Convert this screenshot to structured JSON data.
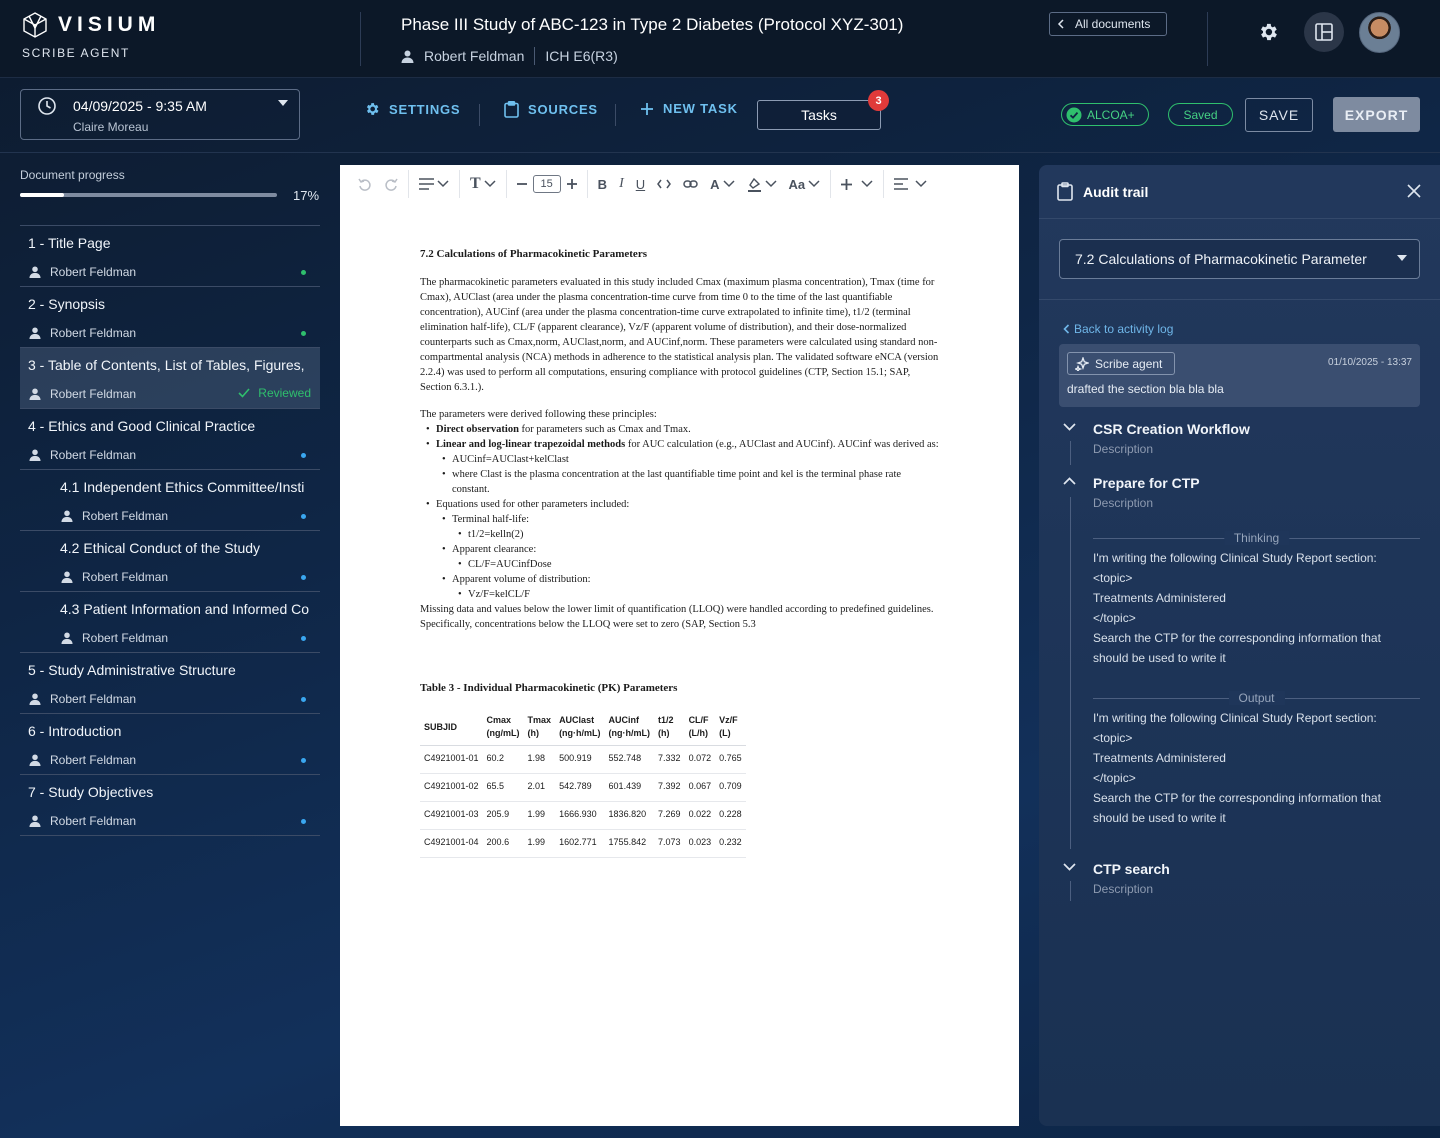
{
  "header": {
    "brand": "VISIUM",
    "brand_sub": "SCRIBE AGENT",
    "doc_title": "Phase III Study of ABC-123 in Type 2 Diabetes (Protocol XYZ-301)",
    "author": "Robert Feldman",
    "guideline": "ICH E6(R3)",
    "all_documents_label": "All documents",
    "icons": [
      "visium-logo-icon",
      "person-icon",
      "chevron-left-icon",
      "gear-icon",
      "layout-icon"
    ]
  },
  "toolbar": {
    "date": "04/09/2025 - 9:35 AM",
    "date_user": "Claire Moreau",
    "settings_label": "SETTINGS",
    "sources_label": "SOURCES",
    "new_task_label": "NEW TASK",
    "tasks_label": "Tasks",
    "tasks_count": "3",
    "alcoa_label": "ALCOA+",
    "saved_label": "Saved",
    "save_label": "SAVE",
    "export_label": "EXPORT",
    "colors": {
      "accent": "#6fc0ef",
      "success": "#2fbf6d",
      "badge": "#e03a3a"
    }
  },
  "sidebar": {
    "progress_label": "Document progress",
    "progress_pct": "17%",
    "progress_value": 0.17,
    "items": [
      {
        "title": "1 - Title Page",
        "user": "Robert Feldman",
        "status": "green"
      },
      {
        "title": "2 - Synopsis",
        "user": "Robert Feldman",
        "status": "green"
      },
      {
        "title": "3 - Table of Contents, List of Tables, Figures,",
        "user": "Robert Feldman",
        "status": "reviewed",
        "reviewed_label": "Reviewed"
      },
      {
        "title": "4 - Ethics and Good Clinical Practice",
        "user": "Robert Feldman",
        "status": "blue"
      },
      {
        "title": "4.1 Independent Ethics Committee/Insti",
        "user": "Robert Feldman",
        "status": "blue"
      },
      {
        "title": "4.2 Ethical Conduct of the Study",
        "user": "Robert Feldman",
        "status": "blue"
      },
      {
        "title": "4.3 Patient Information and Informed Co",
        "user": "Robert Feldman",
        "status": "blue"
      },
      {
        "title": "5 - Study Administrative Structure",
        "user": "Robert Feldman",
        "status": "blue"
      },
      {
        "title": "6 - Introduction",
        "user": "Robert Feldman",
        "status": "blue"
      },
      {
        "title": "7 - Study Objectives",
        "user": "Robert Feldman",
        "status": "blue"
      }
    ]
  },
  "editor": {
    "font_size": "15",
    "section_title": "7.2 Calculations of Pharmacokinetic Parameters",
    "para1": "The pharmacokinetic parameters evaluated in this study included Cmax (maximum plasma concentration), Tmax (time for Cmax), AUClast (area under the plasma concentration-time curve from time 0 to the time of the last quantifiable concentration), AUCinf (area under the plasma concentration-time curve extrapolated to infinite time), t1/2 (terminal elimination half-life), CL/F (apparent clearance), Vz/F (apparent volume of distribution), and their dose-normalized counterparts such as Cmax,norm, AUClast,norm, and AUCinf,norm. These parameters were calculated using standard non-compartmental analysis (NCA) methods in adherence to the statistical analysis plan. The validated software eNCA (version 2.2.4) was used to perform all computations, ensuring compliance with protocol guidelines (CTP, Section 15.1; SAP, Section 6.3.1.).",
    "principles_intro": "The parameters were derived following these principles:",
    "b1_bold": "Direct observation",
    "b1_rest": " for parameters such as Cmax and Tmax.",
    "b2_bold": "Linear and log-linear trapezoidal methods",
    "b2_rest": " for AUC calculation (e.g., AUClast and AUCinf). AUCinf was derived as:",
    "b2_sub1": "AUCinf=AUClast+kelClast",
    "b2_sub2": "where Clast is the plasma concentration at the last quantifiable time point and kel is the terminal phase rate constant.",
    "b3": "Equations used for other parameters included:",
    "b3_s1": "Terminal half-life:",
    "b3_s1_f": "t1/2=kelln(2)",
    "b3_s2": "Apparent clearance:",
    "b3_s2_f": "CL/F=AUCinfDose",
    "b3_s3": "Apparent volume of distribution:",
    "b3_s3_f": "Vz/F=kelCL/F",
    "para_missing": "Missing data and values below the lower limit of quantification (LLOQ) were handled according to predefined guidelines. Specifically, concentrations below the LLOQ were set to zero (SAP, Section 5.3",
    "table_title": "Table 3 -  Individual Pharmacokinetic (PK) Parameters",
    "table": {
      "headers": [
        [
          "SUBJID",
          ""
        ],
        [
          "Cmax",
          "(ng/mL)"
        ],
        [
          "Tmax",
          "(h)"
        ],
        [
          "AUClast",
          "(ng·h/mL)"
        ],
        [
          "AUCinf",
          "(ng·h/mL)"
        ],
        [
          "t1/2",
          "(h)"
        ],
        [
          "CL/F",
          "(L/h)"
        ],
        [
          "Vz/F",
          "(L)"
        ]
      ],
      "rows": [
        [
          "C4921001-01",
          "60.2",
          "1.98",
          "500.919",
          "552.748",
          "7.332",
          "0.072",
          "0.765"
        ],
        [
          "C4921001-02",
          "65.5",
          "2.01",
          "542.789",
          "601.439",
          "7.392",
          "0.067",
          "0.709"
        ],
        [
          "C4921001-03",
          "205.9",
          "1.99",
          "1666.930",
          "1836.820",
          "7.269",
          "0.022",
          "0.228"
        ],
        [
          "C4921001-04",
          "200.6",
          "1.99",
          "1602.771",
          "1755.842",
          "7.073",
          "0.023",
          "0.232"
        ]
      ]
    }
  },
  "audit": {
    "title": "Audit trail",
    "selected_section": "7.2 Calculations of Pharmacokinetic Parameter",
    "back_label": "Back to activity log",
    "agent_label": "Scribe agent",
    "timestamp": "01/10/2025 - 13:37",
    "activity_msg": "drafted the section bla bla bla",
    "workflows": [
      {
        "name": "CSR Creation Workflow",
        "desc": "Description"
      },
      {
        "name": "Prepare for CTP",
        "desc": "Description"
      },
      {
        "name": "CTP search",
        "desc": "Description"
      }
    ],
    "thinking_label": "Thinking",
    "output_label": "Output",
    "thinking_lines": [
      "I'm writing the following Clinical Study Report section:",
      "<topic>",
      "Treatments Administered",
      "</topic>",
      "Search the CTP for the corresponding information that",
      "should be used to write it"
    ],
    "output_lines": [
      "I'm writing the following Clinical Study Report section:",
      "<topic>",
      "Treatments Administered",
      "</topic>",
      "Search the CTP for the corresponding information that",
      "should be used to write it"
    ]
  }
}
